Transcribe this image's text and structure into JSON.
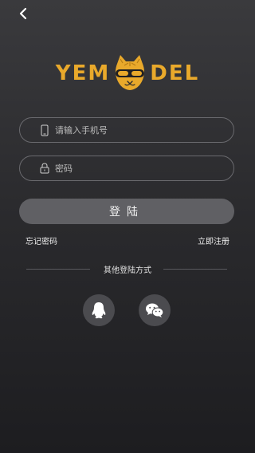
{
  "header": {
    "back_icon": "chevron-left-icon"
  },
  "logo": {
    "left_text": "YEM",
    "right_text": "DEL",
    "brand_color": "#e9a92b"
  },
  "form": {
    "phone_placeholder": "请输入手机号",
    "password_placeholder": "密码",
    "login_label": "登陆"
  },
  "links": {
    "forgot": "忘记密码",
    "register": "立即注册"
  },
  "other_login": {
    "title": "其他登陆方式",
    "providers": [
      {
        "name": "qq",
        "icon": "qq-icon"
      },
      {
        "name": "wechat",
        "icon": "wechat-icon"
      }
    ]
  }
}
